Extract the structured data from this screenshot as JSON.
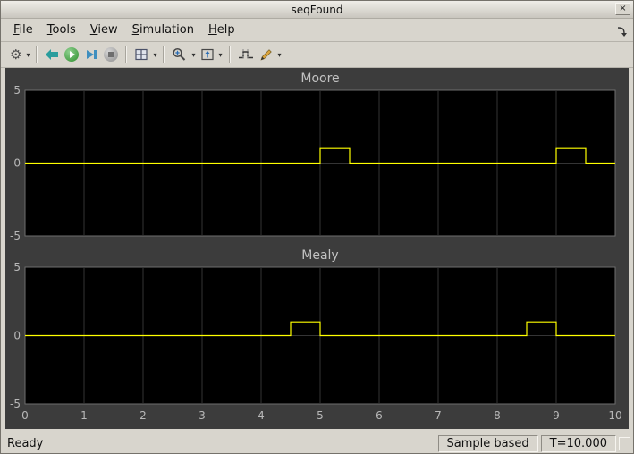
{
  "window": {
    "title": "seqFound"
  },
  "titlebar": {
    "close_glyph": "×"
  },
  "menu": {
    "items": [
      {
        "label": "File",
        "mnemonic": "F"
      },
      {
        "label": "Tools",
        "mnemonic": "T"
      },
      {
        "label": "View",
        "mnemonic": "V"
      },
      {
        "label": "Simulation",
        "mnemonic": "S"
      },
      {
        "label": "Help",
        "mnemonic": "H"
      }
    ]
  },
  "toolbar": {
    "buttons": [
      {
        "name": "configuration-properties",
        "icon": "gear-icon",
        "dropdown": true
      },
      {
        "name": "highlight-simulink-block",
        "icon": "back-arrow-icon",
        "dropdown": false
      },
      {
        "name": "run",
        "icon": "play-icon",
        "dropdown": false
      },
      {
        "name": "step-forward",
        "icon": "step-forward-icon",
        "dropdown": false
      },
      {
        "name": "stop",
        "icon": "stop-icon",
        "dropdown": false,
        "disabled": true
      },
      {
        "name": "layout",
        "icon": "layout-grid-icon",
        "dropdown": true
      },
      {
        "name": "zoom",
        "icon": "magnifier-icon",
        "dropdown": true
      },
      {
        "name": "scale-axes",
        "icon": "autoscale-icon",
        "dropdown": true
      },
      {
        "name": "cursor-measurements",
        "icon": "cursor-measurements-icon",
        "dropdown": false
      },
      {
        "name": "measurements",
        "icon": "pencil-icon",
        "dropdown": true
      }
    ]
  },
  "status": {
    "ready": "Ready",
    "sample_mode": "Sample based",
    "time": "T=10.000"
  },
  "colors": {
    "signal": "#ffff00",
    "plot_bg": "#000000",
    "panel_bg": "#3c3c3c",
    "grid": "#353535",
    "plot_border": "#6e6e6e",
    "tick_label": "#b8b8b8",
    "title": "#c2c2c2"
  },
  "chart_data": [
    {
      "type": "line",
      "title": "Moore",
      "x": [
        0,
        5,
        5,
        5.5,
        5.5,
        9,
        9,
        9.5,
        9.5,
        10
      ],
      "y": [
        0,
        0,
        1,
        1,
        0,
        0,
        1,
        1,
        0,
        0
      ],
      "xlim": [
        0,
        10
      ],
      "ylim": [
        -5,
        5
      ],
      "xticks": [
        0,
        1,
        2,
        3,
        4,
        5,
        6,
        7,
        8,
        9,
        10
      ],
      "yticks": [
        -5,
        0,
        5
      ],
      "grid": true,
      "line_color": "#ffff00"
    },
    {
      "type": "line",
      "title": "Mealy",
      "x": [
        0,
        4.5,
        4.5,
        5,
        5,
        8.5,
        8.5,
        9,
        9,
        10
      ],
      "y": [
        0,
        0,
        1,
        1,
        0,
        0,
        1,
        1,
        0,
        0
      ],
      "xlim": [
        0,
        10
      ],
      "ylim": [
        -5,
        5
      ],
      "xticks": [
        0,
        1,
        2,
        3,
        4,
        5,
        6,
        7,
        8,
        9,
        10
      ],
      "yticks": [
        -5,
        0,
        5
      ],
      "grid": true,
      "line_color": "#ffff00"
    }
  ]
}
